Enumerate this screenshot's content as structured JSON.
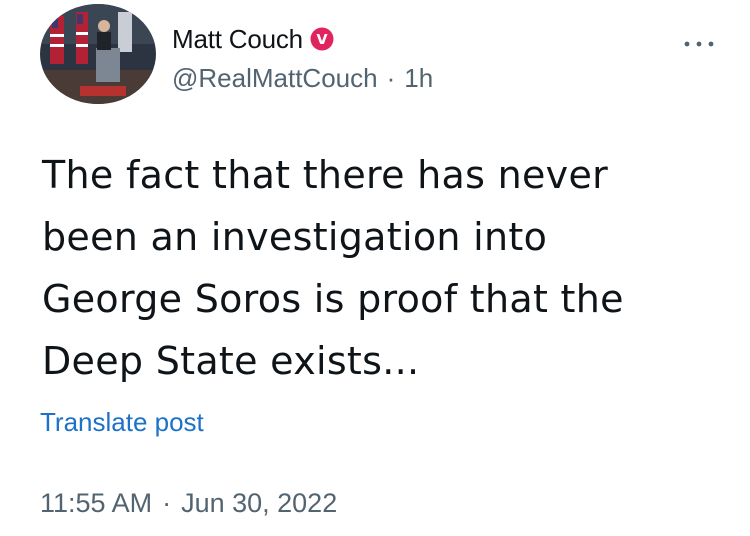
{
  "author": {
    "display_name": "Matt Couch",
    "handle": "@RealMattCouch",
    "time_ago": "1h",
    "separator": "·",
    "badge_icon": "verified-v-badge-icon",
    "badge_color": "#e0245e"
  },
  "post": {
    "lines": [
      "The fact that there has never",
      "been an investigation into",
      "George Soros is proof that the",
      "Deep State exists..."
    ]
  },
  "translate_label": "Translate post",
  "footer": {
    "time": "11:55 AM",
    "separator": "·",
    "date": "Jun 30, 2022"
  },
  "more_icon": "more-horizontal-icon",
  "colors": {
    "text": "#0f1419",
    "secondary": "#536471",
    "link": "#1d72c8"
  }
}
